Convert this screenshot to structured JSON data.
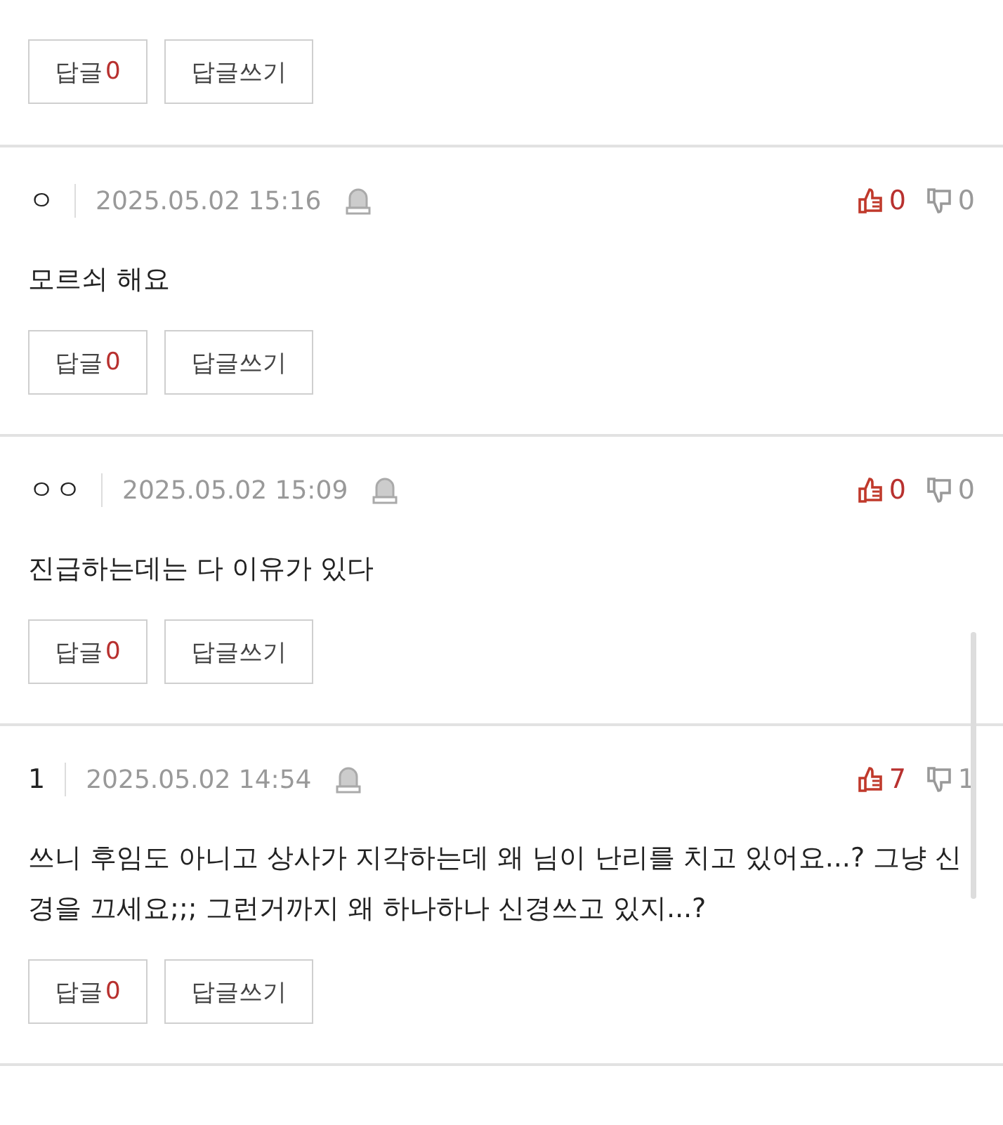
{
  "top_comment": {
    "reply_label": "답글",
    "reply_count": "0",
    "write_reply": "답글쓰기"
  },
  "comments": [
    {
      "author": "ㅇ",
      "date": "2025.05.02 15:16",
      "likes": "0",
      "dislikes": "0",
      "body": "모르쇠 해요",
      "reply_label": "답글",
      "reply_count": "0",
      "write_reply": "답글쓰기"
    },
    {
      "author": "ㅇㅇ",
      "date": "2025.05.02 15:09",
      "likes": "0",
      "dislikes": "0",
      "body": "진급하는데는 다 이유가 있다",
      "reply_label": "답글",
      "reply_count": "0",
      "write_reply": "답글쓰기"
    },
    {
      "author": "1",
      "date": "2025.05.02 14:54",
      "likes": "7",
      "dislikes": "1",
      "body": "쓰니 후임도 아니고 상사가 지각하는데 왜 님이 난리를 치고 있어요...? 그냥 신경을 끄세요;;; 그런거까지 왜 하나하나 신경쓰고 있지...?",
      "reply_label": "답글",
      "reply_count": "0",
      "write_reply": "답글쓰기"
    }
  ]
}
